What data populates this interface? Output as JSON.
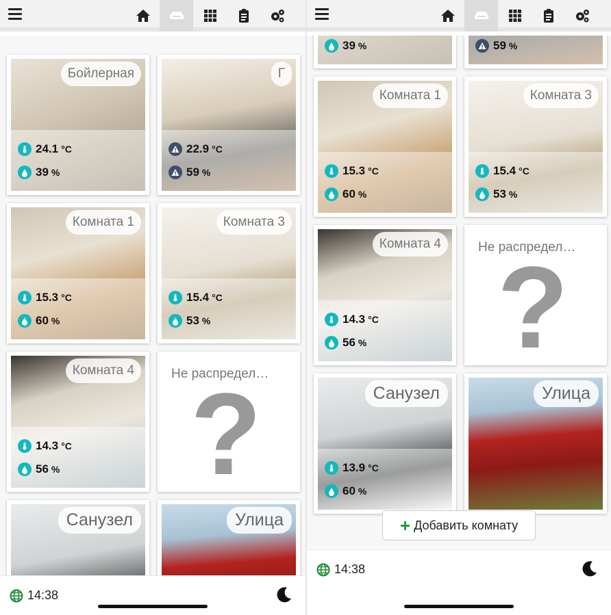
{
  "time": "14:38",
  "add_room_label": "Добавить комнату",
  "colors": {
    "accent_teal": "#11b8c0",
    "warning": "#3f4e6a",
    "plus_green": "#1a9b3a"
  },
  "nav": [
    "menu-icon",
    "home-icon",
    "sofa-icon",
    "grid-icon",
    "clipboard-icon",
    "gears-icon"
  ],
  "rooms": {
    "boiler": {
      "name": "Бойлерная",
      "temp": "24.1",
      "hum": "39"
    },
    "g": {
      "name": "Г",
      "temp": "22.9",
      "hum": "59"
    },
    "k1": {
      "name": "Комната 1",
      "temp": "15.3",
      "hum": "60"
    },
    "k3": {
      "name": "Комната 3",
      "temp": "15.4",
      "hum": "53"
    },
    "k4": {
      "name": "Комната 4",
      "temp": "14.3",
      "hum": "56"
    },
    "unassigned": {
      "name": "Не распредел…"
    },
    "bath": {
      "name": "Санузел",
      "temp": "13.9",
      "hum": "60"
    },
    "street": {
      "name": "Улица"
    }
  },
  "units": {
    "temp": "°C",
    "hum": "%"
  },
  "question_mark": "?"
}
